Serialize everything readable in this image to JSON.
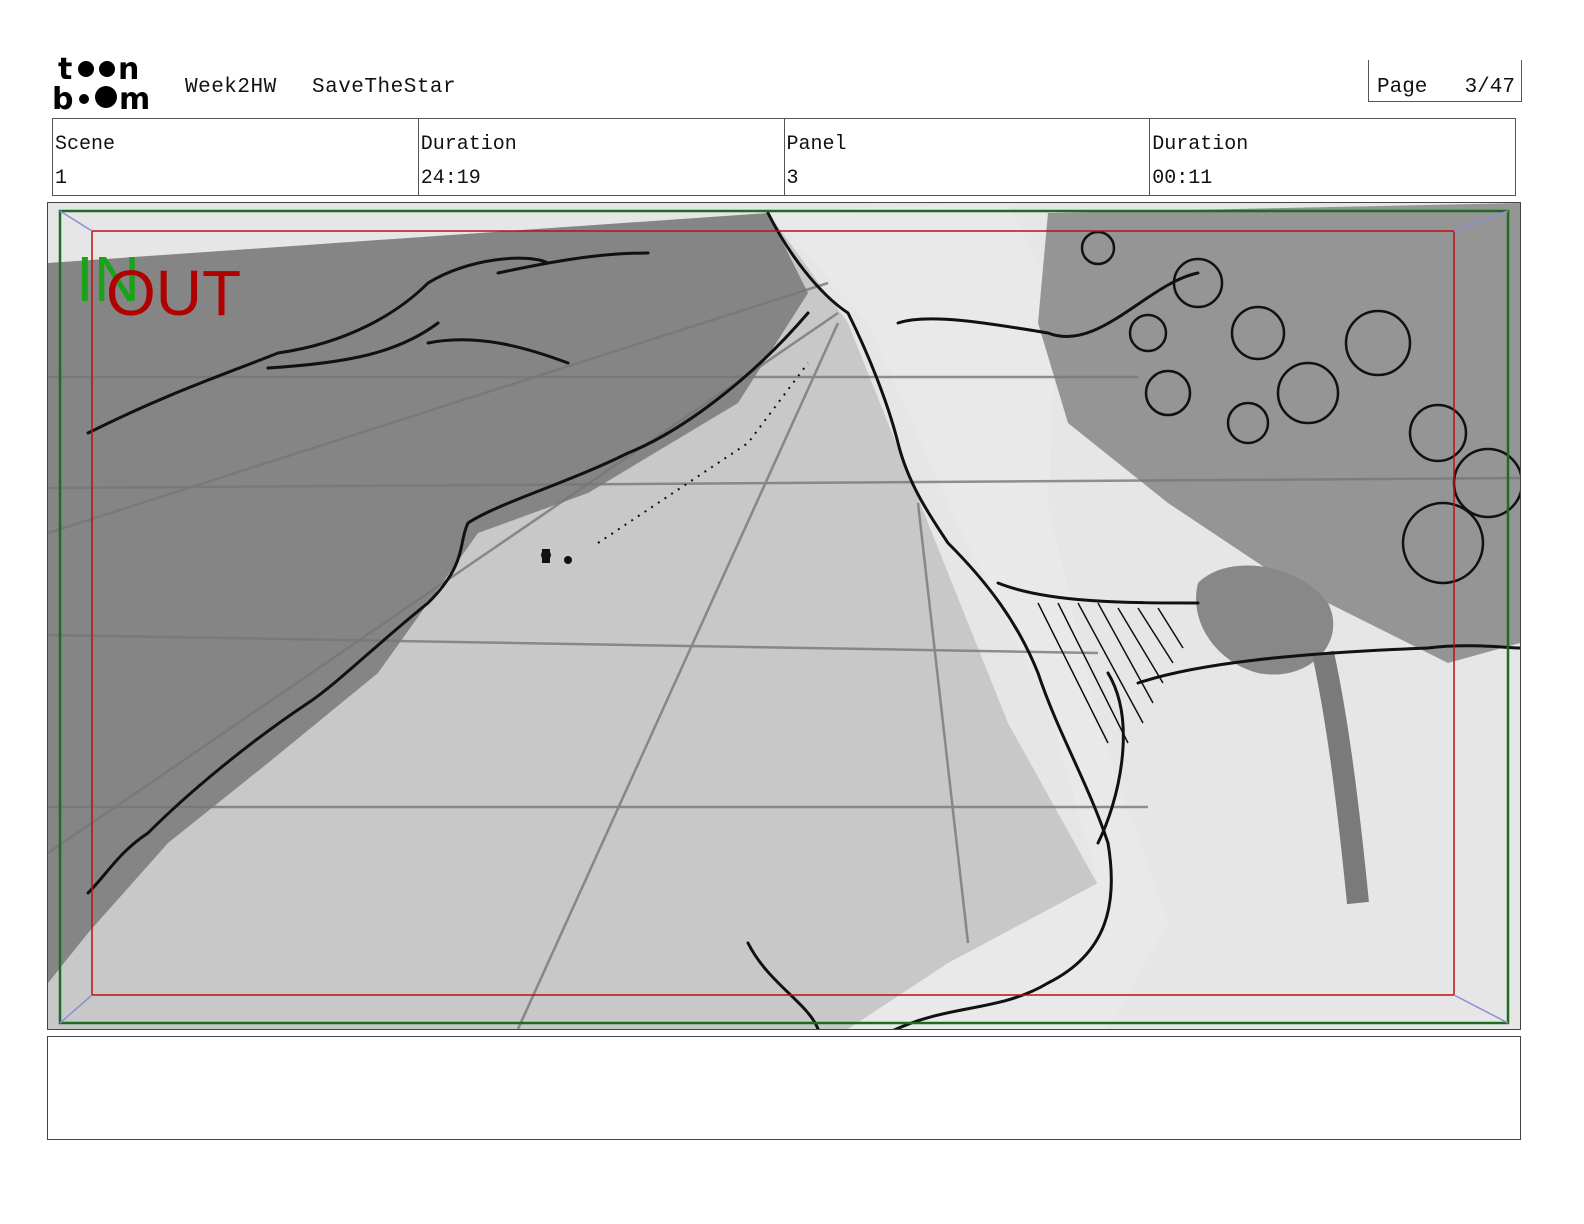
{
  "header": {
    "logo_text": "toonboom",
    "project": "Week2HW",
    "title": "SaveTheStar",
    "page_label": "Page",
    "page_value": "3/47"
  },
  "info": {
    "scene_label": "Scene",
    "scene_value": "1",
    "scene_duration_label": "Duration",
    "scene_duration_value": "24:19",
    "panel_label": "Panel",
    "panel_value": "3",
    "panel_duration_label": "Duration",
    "panel_duration_value": "00:11"
  },
  "panel": {
    "in_marker": "IN",
    "out_marker": "OUT",
    "colors": {
      "in_frame": "#1f6b1f",
      "out_frame": "#c01010",
      "in_text": "#19a319",
      "out_text": "#b00000"
    }
  },
  "notes": {
    "text": ""
  }
}
